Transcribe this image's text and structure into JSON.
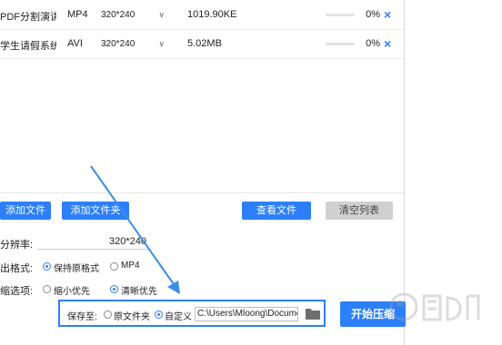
{
  "files": [
    {
      "name": "PDF分割演讲...",
      "format": "MP4",
      "resolution": "320*240",
      "size": "1019.90KE",
      "progress": 0,
      "percent": "0%"
    },
    {
      "name": "学生请假系统...",
      "format": "AVI",
      "resolution": "320*240",
      "size": "5.02MB",
      "progress": 0,
      "percent": "0%"
    }
  ],
  "delete_glyph": "×",
  "toolbar": {
    "add_file": "添加文件",
    "add_folder": "添加文件夹",
    "view_file": "查看文件",
    "clear_list": "清空列表"
  },
  "settings": {
    "resolution_label": "分辨率:",
    "resolution_value": "320*240",
    "output_format_label": "出格式:",
    "output_format_options": [
      "保持原格式",
      "MP4"
    ],
    "output_format_selected": 0,
    "compress_label": "缩选项:",
    "compress_options": [
      "缩小优先",
      "清晰优先"
    ],
    "compress_selected": 1
  },
  "save": {
    "label": "保存至:",
    "options": [
      "原文件夹",
      "自定义"
    ],
    "selected": 1,
    "path": "C:\\Users\\Mloong\\Documents"
  },
  "start_button": "开始压缩",
  "colors": {
    "accent": "#2d7ff9",
    "arrow": "#3a8ee6"
  }
}
